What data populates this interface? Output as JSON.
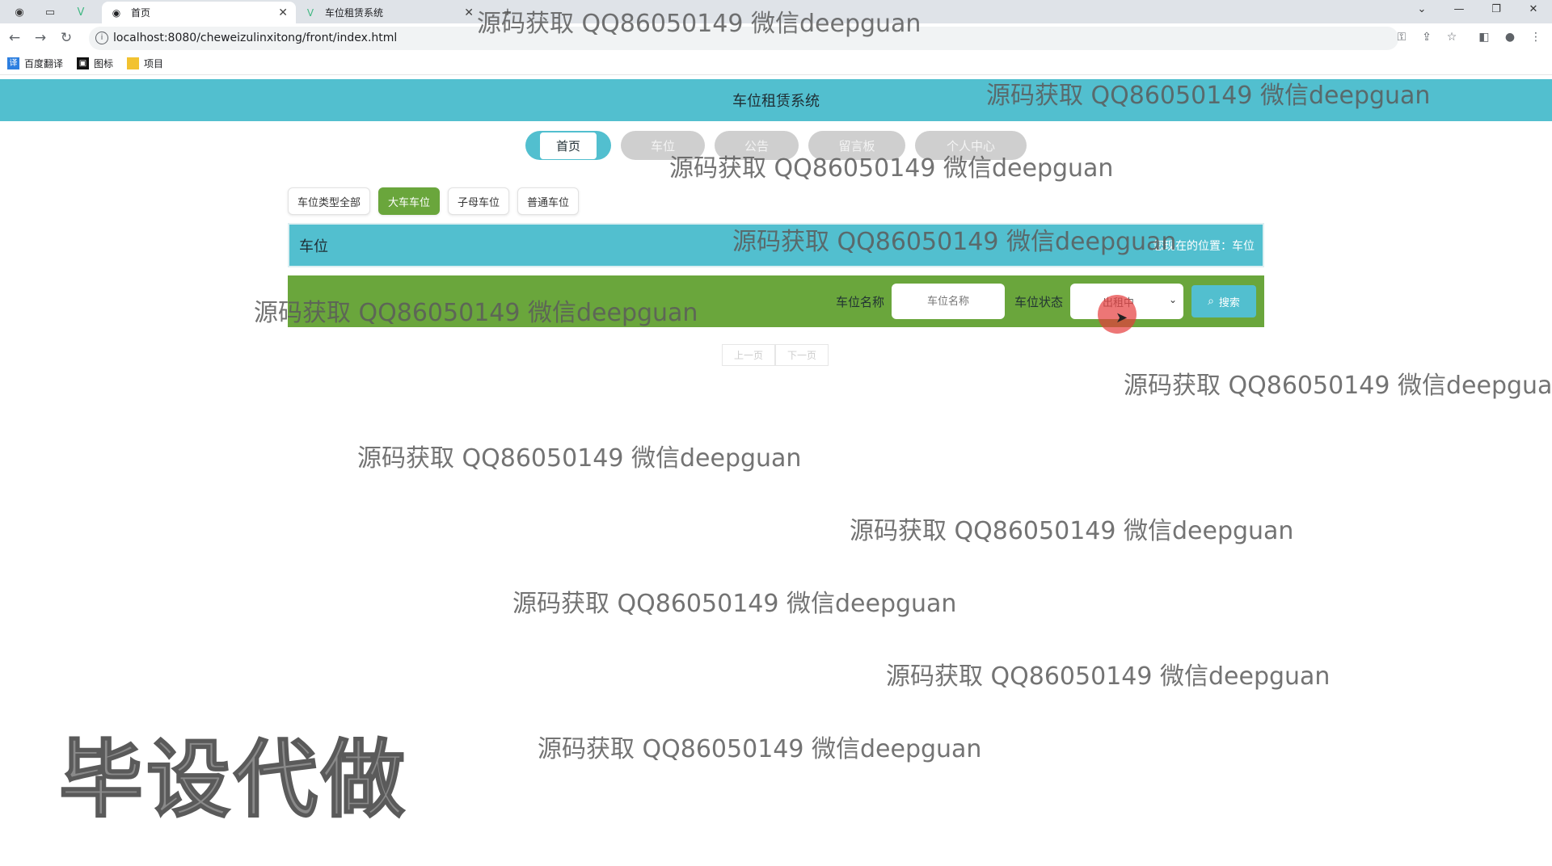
{
  "browser": {
    "tabs": [
      {
        "title": "首页",
        "icon": "globe-icon",
        "active": true
      },
      {
        "title": "车位租赁系统",
        "icon": "vue-icon",
        "active": false
      }
    ],
    "url": "localhost:8080/cheweizulinxitong/front/index.html",
    "bookmarks": [
      {
        "label": "百度翻译",
        "color": "#2d7fe0"
      },
      {
        "label": "图标",
        "color": "#111111"
      },
      {
        "label": "项目",
        "color": "#f2c230"
      }
    ]
  },
  "site": {
    "title": "车位租赁系统",
    "menu": [
      {
        "label": "首页",
        "active": true
      },
      {
        "label": "车位",
        "active": false
      },
      {
        "label": "公告",
        "active": false
      },
      {
        "label": "留言板",
        "active": false
      },
      {
        "label": "个人中心",
        "active": false
      }
    ],
    "filters": [
      {
        "label": "车位类型全部",
        "active": false
      },
      {
        "label": "大车车位",
        "active": true
      },
      {
        "label": "子母车位",
        "active": false
      },
      {
        "label": "普通车位",
        "active": false
      }
    ],
    "section_title": "车位",
    "location_text": "您现在的位置：车位",
    "search": {
      "name_label": "车位名称",
      "name_placeholder": "车位名称",
      "status_label": "车位状态",
      "status_value": "出租中",
      "button_label": "搜索"
    },
    "pager": {
      "prev": "上一页",
      "next": "下一页"
    }
  },
  "watermark": {
    "text": "源码获取 QQ86050149 微信deepguan",
    "big_text": "毕设代做"
  },
  "colors": {
    "teal": "#52bfcf",
    "green": "#6aa63c"
  }
}
